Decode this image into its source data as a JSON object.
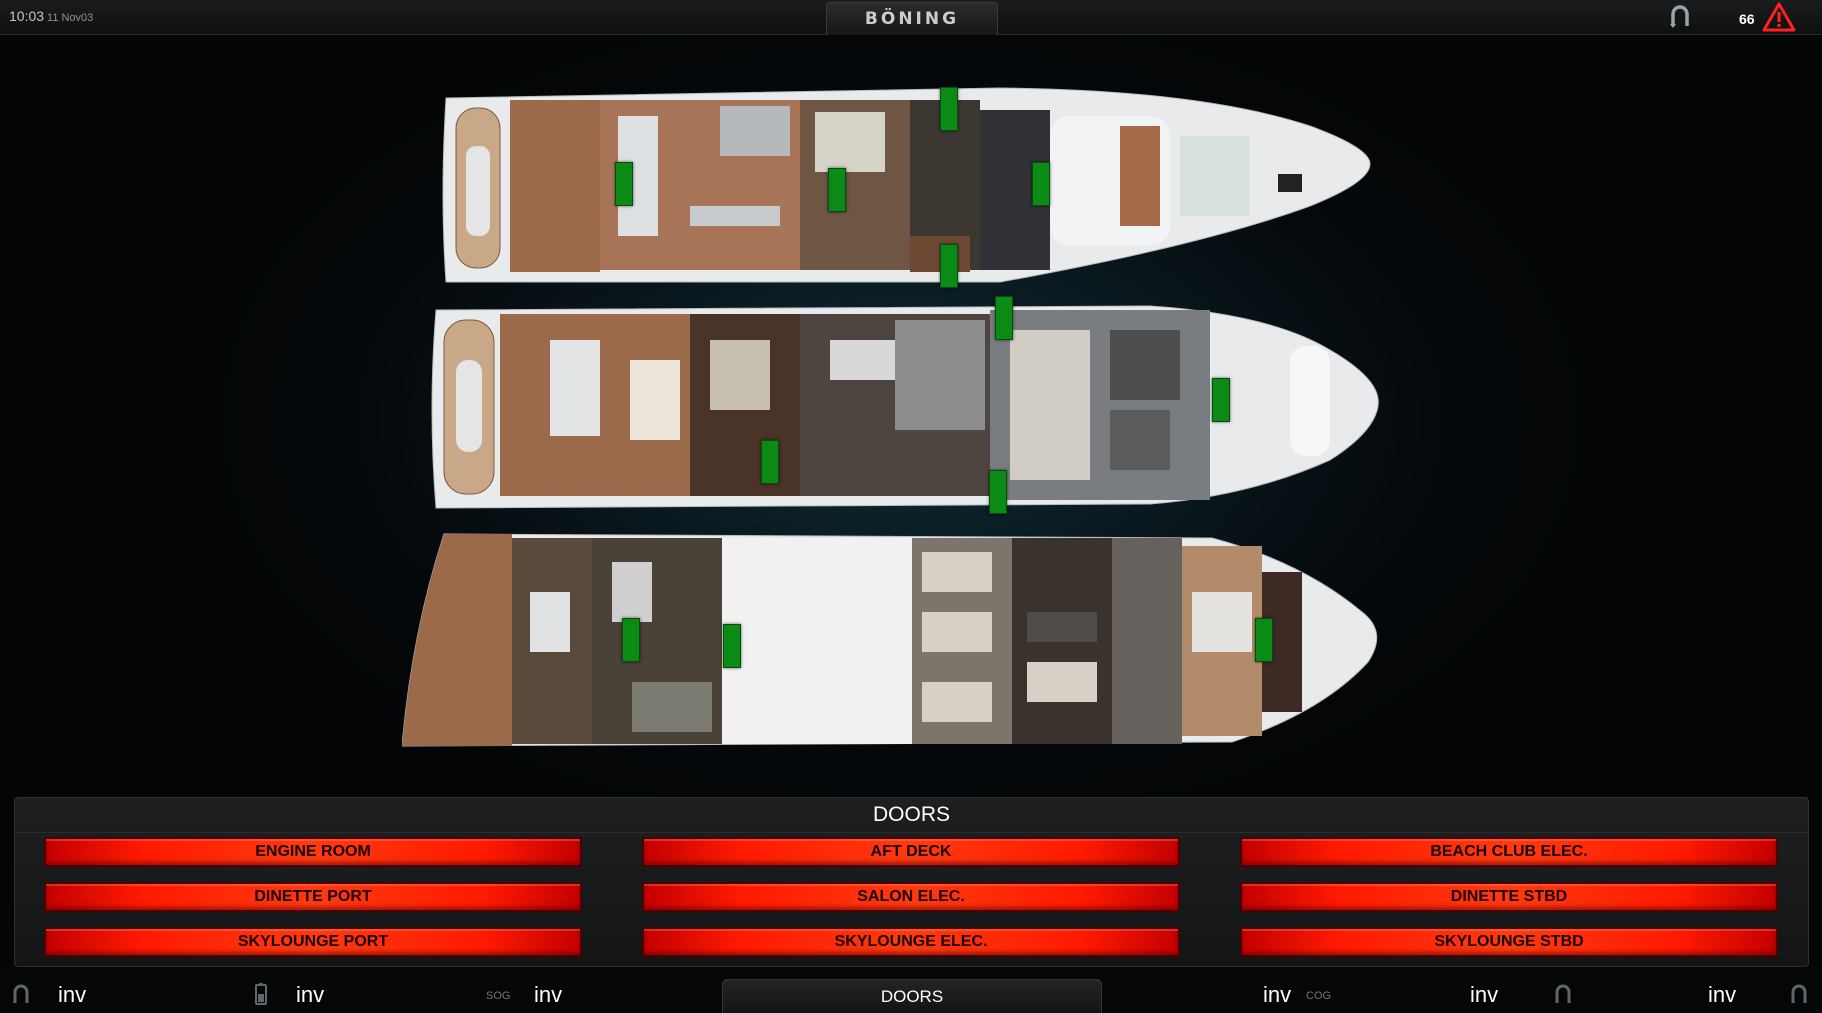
{
  "status": {
    "time": "10:03",
    "seconds": "11",
    "date": "Nov03",
    "brand": "BÖNING",
    "alarm_count": "66"
  },
  "doors_panel": {
    "title": "DOORS",
    "buttons": [
      {
        "label": "ENGINE ROOM"
      },
      {
        "label": "AFT DECK"
      },
      {
        "label": "BEACH CLUB ELEC."
      },
      {
        "label": "DINETTE PORT"
      },
      {
        "label": "SALON ELEC."
      },
      {
        "label": "DINETTE STBD"
      },
      {
        "label": "SKYLOUNGE PORT"
      },
      {
        "label": "SKYLOUNGE ELEC."
      },
      {
        "label": "SKYLOUNGE STBD"
      }
    ],
    "button_color": "#ff2a00"
  },
  "door_status_color": "#0b8a16",
  "bottom_bar": {
    "items": [
      {
        "icon": "horseshoe-icon",
        "value": "inv",
        "label": ""
      },
      {
        "icon": "battery-icon",
        "value": "inv",
        "label": ""
      },
      {
        "icon": "",
        "value": "inv",
        "label": "SOG"
      },
      {
        "icon": "",
        "value": "inv",
        "label": "COG"
      },
      {
        "icon": "",
        "value": "inv",
        "label": ""
      },
      {
        "icon": "horseshoe-icon",
        "value": "inv",
        "label": ""
      }
    ],
    "active_tab": "DOORS"
  }
}
